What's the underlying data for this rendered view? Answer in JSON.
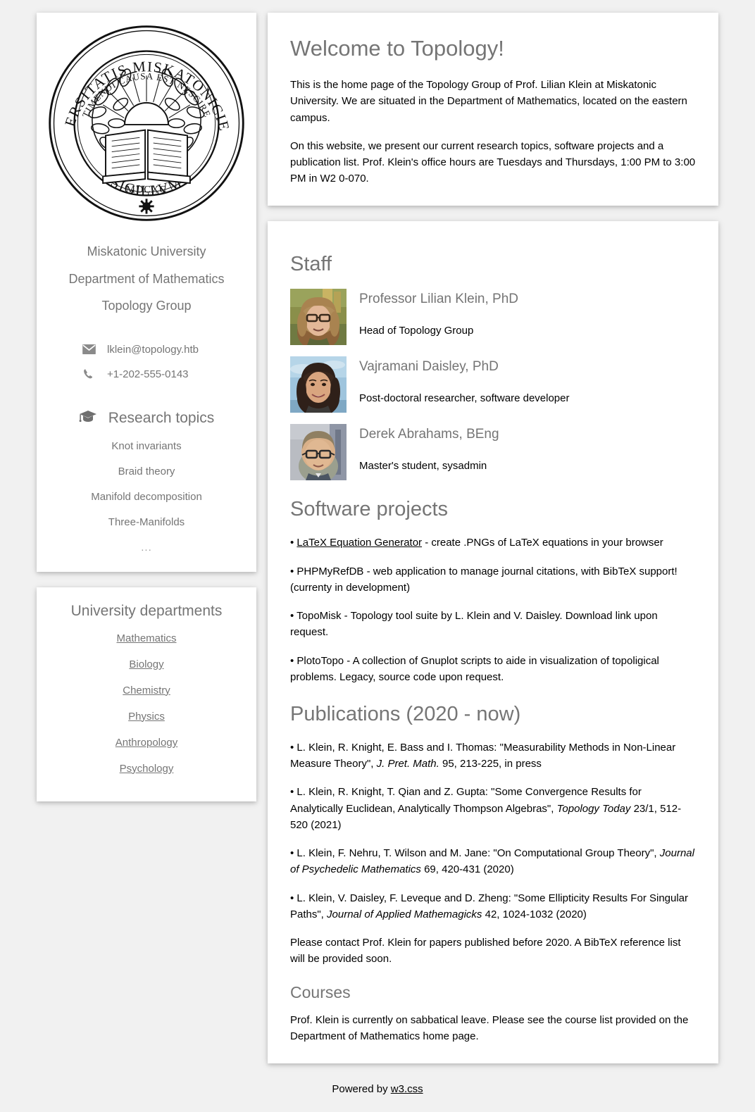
{
  "colors": {
    "page_background": "#f1f1f1",
    "card_background": "#ffffff",
    "heading_gray": "#757575",
    "body_text": "#000000"
  },
  "sidebar": {
    "seal": {
      "icon": "university-seal",
      "outer_text": "SIGILLVM VNIVERSITATIS MISKATONICIENSIS",
      "inner_text": "TIMENDI CAUSA EST NESCIRE",
      "year": "MDCXC"
    },
    "org_lines": [
      "Miskatonic University",
      "Department of Mathematics",
      "Topology Group"
    ],
    "contacts": [
      {
        "icon": "envelope-icon",
        "value": "lklein@topology.htb"
      },
      {
        "icon": "phone-icon",
        "value": "+1-202-555-0143"
      }
    ],
    "research": {
      "icon": "graduation-cap-icon",
      "title": "Research topics",
      "items": [
        "Knot invariants",
        "Braid theory",
        "Manifold decomposition",
        "Three-Manifolds",
        "..."
      ]
    },
    "departments": {
      "title": "University departments",
      "links": [
        "Mathematics",
        "Biology",
        "Chemistry",
        "Physics",
        "Anthropology",
        "Psychology"
      ]
    }
  },
  "main": {
    "welcome": {
      "title": "Welcome to Topology!",
      "paragraph1": "This is the home page of the Topology Group of Prof. Lilian Klein at Miskatonic University. We are situated in the Department of Mathematics, located on the eastern campus.",
      "paragraph2": "On this website, we present our current research topics, software projects and a publication list. Prof. Klein's office hours are Tuesdays and Thursdays, 1:00 PM to 3:00 PM in W2 0-070."
    },
    "staff": {
      "title": "Staff",
      "members": [
        {
          "photo": "portrait-woman-glasses",
          "name": "Professor Lilian Klein, PhD",
          "role": "Head of Topology Group"
        },
        {
          "photo": "portrait-woman-dark-hair",
          "name": "Vajramani Daisley, PhD",
          "role": "Post-doctoral researcher, software developer"
        },
        {
          "photo": "portrait-man-glasses",
          "name": "Derek Abrahams, BEng",
          "role": "Master's student, sysadmin"
        }
      ]
    },
    "software": {
      "title": "Software projects",
      "items": [
        {
          "bullet": "• ",
          "link": "LaTeX Equation Generator",
          "rest": " - create .PNGs of LaTeX equations in your browser"
        },
        {
          "bullet": "• ",
          "link": "",
          "rest": "PHPMyRefDB - web application to manage journal citations, with BibTeX support! (currenty in development)"
        },
        {
          "bullet": "• ",
          "link": "",
          "rest": "TopoMisk - Topology tool suite by L. Klein and V. Daisley. Download link upon request."
        },
        {
          "bullet": "• ",
          "link": "",
          "rest": "PlotoTopo - A collection of Gnuplot scripts to aide in visualization of topoligical problems. Legacy, source code upon request."
        }
      ]
    },
    "publications": {
      "title": "Publications (2020 - now)",
      "items": [
        {
          "pre": "• L. Klein, R. Knight, E. Bass and I. Thomas: \"Measurability Methods in Non-Linear Measure Theory\", ",
          "journal": "J. Pret. Math.",
          "post": " 95, 213-225, in press"
        },
        {
          "pre": "• L. Klein, R. Knight, T. Qian and Z. Gupta: \"Some Convergence Results for Analytically Euclidean, Analytically Thompson Algebras\", ",
          "journal": "Topology Today",
          "post": " 23/1, 512-520 (2021)"
        },
        {
          "pre": "• L. Klein, F. Nehru, T. Wilson and M. Jane: \"On Computational Group Theory\", ",
          "journal": "Journal of Psychedelic Mathematics",
          "post": " 69, 420-431 (2020)"
        },
        {
          "pre": "• L. Klein, V. Daisley, F. Leveque and D. Zheng: \"Some Ellipticity Results For Singular Paths\", ",
          "journal": "Journal of Applied Mathemagicks",
          "post": " 42, 1024-1032 (2020)"
        }
      ],
      "note": "Please contact Prof. Klein for papers published before 2020. A BibTeX reference list will be provided soon."
    },
    "courses": {
      "title": "Courses",
      "text": "Prof. Klein is currently on sabbatical leave. Please see the course list provided on the Department of Mathematics home page."
    }
  },
  "footer": {
    "prefix": "Powered by ",
    "link": "w3.css"
  }
}
